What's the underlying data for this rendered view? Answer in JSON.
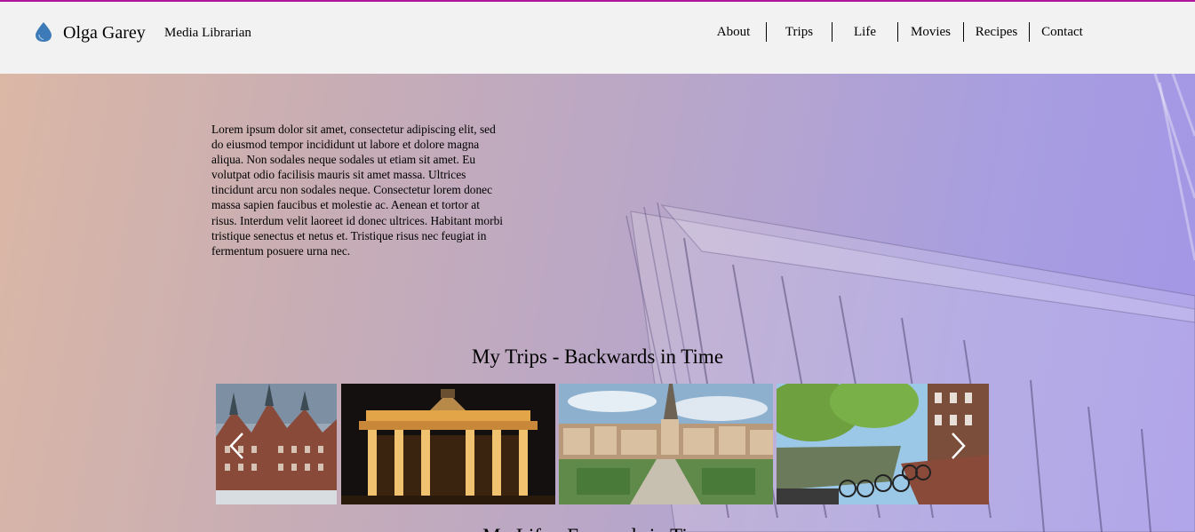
{
  "header": {
    "brand": "Olga Garey",
    "tagline": "Media Librarian",
    "logo_icon": "droplet-icon",
    "nav": [
      {
        "label": "About"
      },
      {
        "label": "Trips"
      },
      {
        "label": "Life"
      },
      {
        "label": "Movies"
      },
      {
        "label": "Recipes"
      },
      {
        "label": "Contact"
      }
    ]
  },
  "intro": {
    "text": "Lorem ipsum dolor sit amet, consectetur adipiscing elit, sed do eiusmod tempor incididunt ut labore et dolore magna aliqua. Non sodales neque sodales ut etiam sit amet. Eu volutpat odio facilisis mauris sit amet massa. Ultrices tincidunt arcu non sodales neque. Consectetur lorem donec massa sapien faucibus et molestie ac. Aenean et tortor at risus. Interdum velit laoreet id donec ultrices. Habitant morbi tristique senectus et netus et. Tristique risus nec feugiat in fermentum posuere urna nec."
  },
  "trips": {
    "title": "My Trips - Backwards in Time",
    "prev_icon": "chevron-left-icon",
    "next_icon": "chevron-right-icon"
  },
  "life": {
    "title": "My Life - Forwards in Time"
  },
  "colors": {
    "accent": "#b0149a",
    "header_bg": "#f2f2f2",
    "hero_start": "#dbb7a5",
    "hero_end": "#a395e6"
  }
}
